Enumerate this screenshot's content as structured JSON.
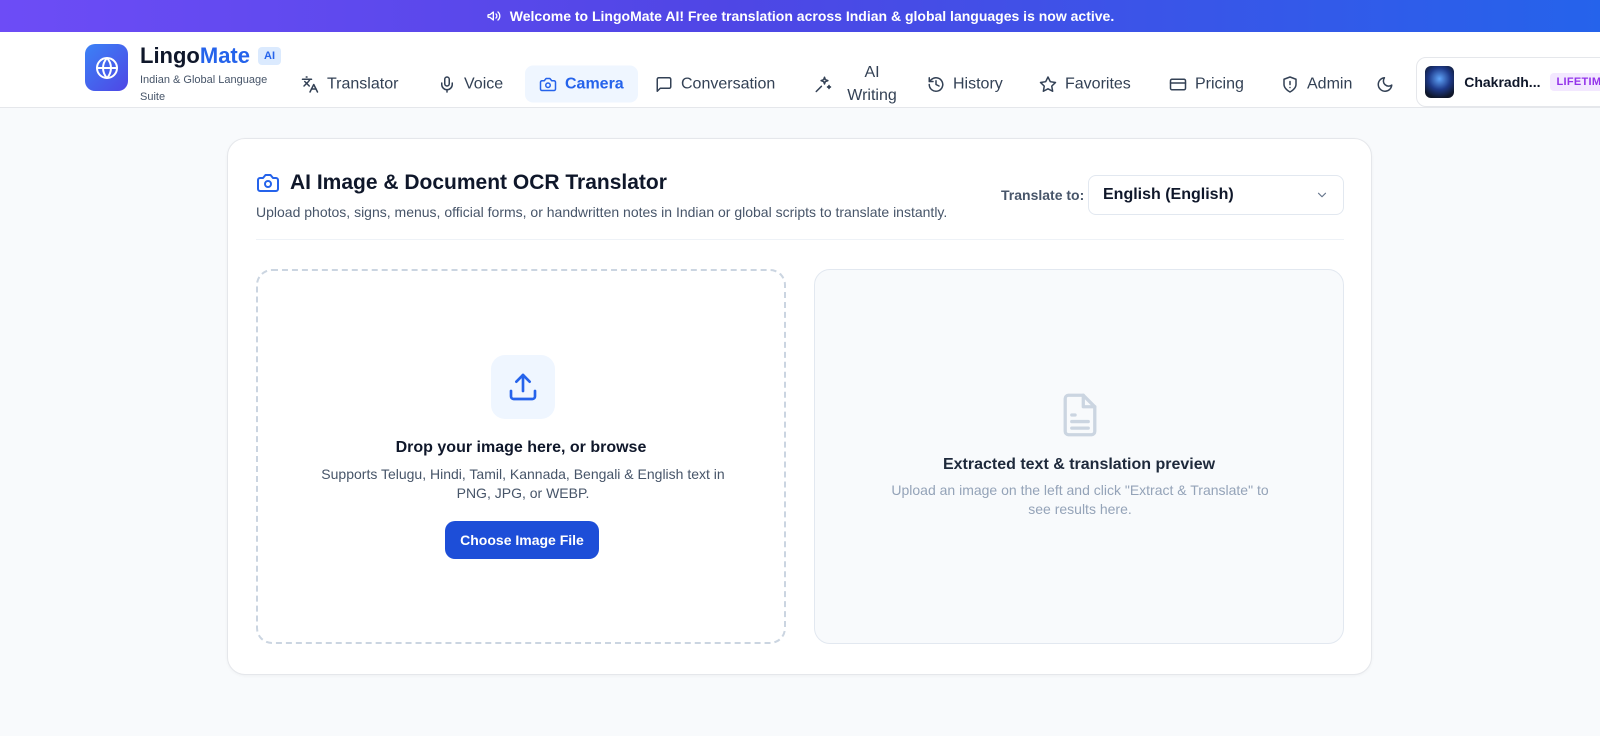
{
  "banner": {
    "text": "Welcome to LingoMate AI! Free translation across Indian & global languages is now active.",
    "icon": "megaphone-icon"
  },
  "brand": {
    "name_part1": "Lingo",
    "name_part2": "Mate",
    "badge": "AI",
    "subtitle": "Indian & Global Language Suite",
    "logo_icon": "globe-icon"
  },
  "nav": {
    "items": [
      {
        "label": "Translator",
        "icon": "translate-icon"
      },
      {
        "label": "Voice",
        "icon": "microphone-icon"
      },
      {
        "label": "Camera",
        "icon": "camera-icon",
        "active": true
      },
      {
        "label": "Conversation",
        "icon": "chat-icon"
      },
      {
        "label": "AI Writing",
        "icon": "sparkles-icon"
      },
      {
        "label": "History",
        "icon": "history-icon"
      },
      {
        "label": "Favorites",
        "icon": "star-icon"
      },
      {
        "label": "Pricing",
        "icon": "credit-card-icon"
      },
      {
        "label": "Admin",
        "icon": "shield-icon"
      }
    ],
    "theme_toggle_icon": "moon-icon"
  },
  "user": {
    "name": "Chakradh...",
    "plan": "LIFETIME"
  },
  "ocr": {
    "title": "AI Image & Document OCR Translator",
    "description": "Upload photos, signs, menus, official forms, or handwritten notes in Indian or global scripts to translate instantly.",
    "translate_label": "Translate to:",
    "target_language": "English (English)"
  },
  "upload": {
    "title": "Drop your image here, or browse",
    "subtitle": "Supports Telugu, Hindi, Tamil, Kannada, Bengali & English text in PNG, JPG, or WEBP.",
    "button": "Choose Image File"
  },
  "preview": {
    "title": "Extracted text & translation preview",
    "subtitle": "Upload an image on the left and click \"Extract & Translate\" to see results here."
  },
  "colors": {
    "accent": "#2563eb",
    "banner_start": "#6d4cf6",
    "banner_end": "#2563eb",
    "plan_badge": "#9333ea"
  }
}
